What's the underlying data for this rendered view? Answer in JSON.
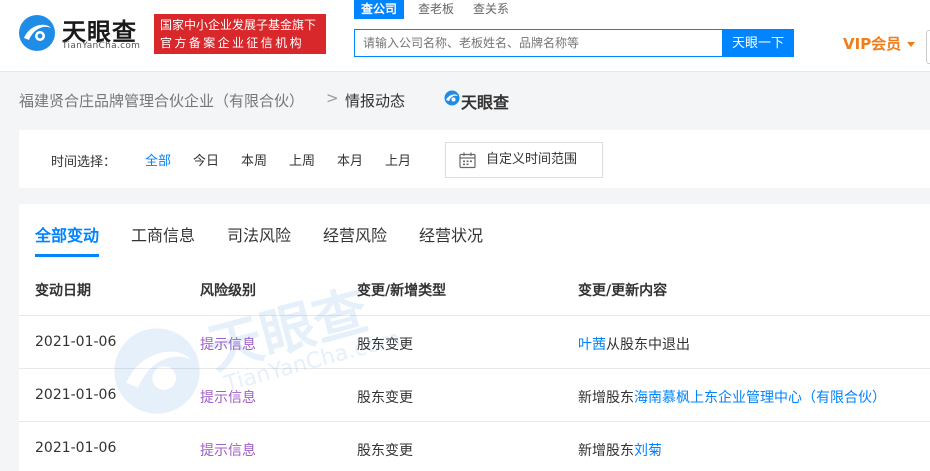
{
  "header": {
    "logo_cn": "天眼查",
    "logo_en": "TianYanCha.com",
    "badge_line1": "国家中小企业发展子基金旗下",
    "badge_line2": "官方备案企业征信机构",
    "search_tabs": [
      "查公司",
      "查老板",
      "查关系"
    ],
    "search_placeholder": "请输入公司名称、老板姓名、品牌名称等",
    "search_button": "天眼一下",
    "vip_label": "VIP会员",
    "colors": {
      "accent": "#0084ff",
      "badge": "#d8282b",
      "vip": "#f07d1a"
    }
  },
  "breadcrumb": {
    "company": "福建贤合庄品牌管理合伙企业（有限合伙）",
    "separator": ">",
    "current": "情报动态",
    "logo_text": "天眼查"
  },
  "time_filter": {
    "label": "时间选择：",
    "options": [
      "全部",
      "今日",
      "本周",
      "上周",
      "本月",
      "上月"
    ],
    "selected": "全部",
    "custom_range": "自定义时间范围"
  },
  "main": {
    "tabs": [
      "全部变动",
      "工商信息",
      "司法风险",
      "经营风险",
      "经营状况"
    ],
    "active_tab": "全部变动",
    "columns": [
      "变动日期",
      "风险级别",
      "变更/新增类型",
      "变更/更新内容"
    ],
    "rows": [
      {
        "date": "2021-01-06",
        "risk": "提示信息",
        "type": "股东变更",
        "prefix": "",
        "link": "叶茜",
        "suffix": "从股东中退出"
      },
      {
        "date": "2021-01-06",
        "risk": "提示信息",
        "type": "股东变更",
        "prefix": "新增股东",
        "link": "海南慕枫上东企业管理中心（有限合伙）",
        "suffix": ""
      },
      {
        "date": "2021-01-06",
        "risk": "提示信息",
        "type": "股东变更",
        "prefix": "新增股东",
        "link": "刘菊",
        "suffix": ""
      }
    ],
    "risk_color": "#a15ec7"
  },
  "watermark": {
    "cn": "天眼查",
    "en": "TianYanCha.com"
  }
}
